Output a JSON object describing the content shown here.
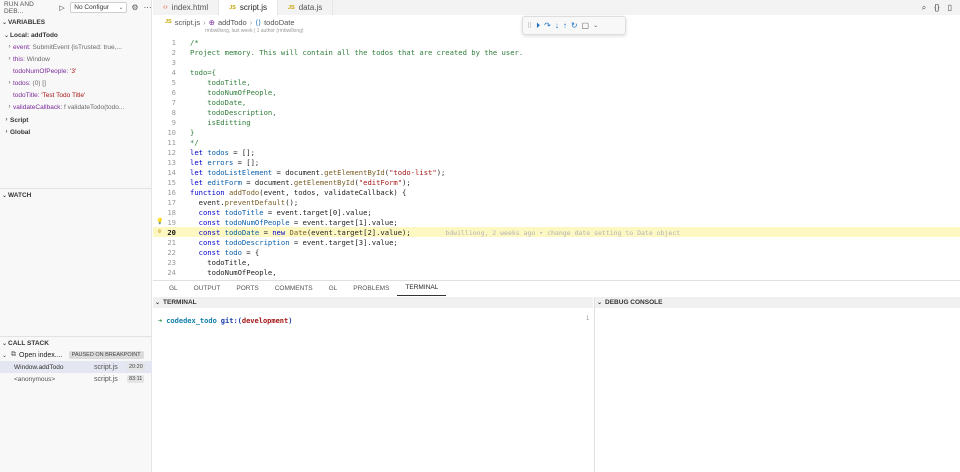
{
  "sidebar": {
    "title": "RUN AND DEB...",
    "config": "No Configur",
    "variables_header": "VARIABLES",
    "local_header": "Local: addTodo",
    "vars": [
      {
        "name": "event:",
        "value": "SubmitEvent {isTrusted: true,..."
      },
      {
        "name": "this:",
        "value": "Window"
      },
      {
        "name": "todoNumOfPeople:",
        "value": "'3'"
      },
      {
        "name": "todos:",
        "value": "(0) []"
      },
      {
        "name": "todoTitle:",
        "value": "'Test Todo Title'"
      },
      {
        "name": "validateCallback:",
        "value": "f validateTodo(todo..."
      }
    ],
    "script_header": "Script",
    "global_header": "Global",
    "watch_header": "WATCH",
    "callstack_header": "CALL STACK",
    "callstack_thread": "Open index....",
    "callstack_status": "PAUSED ON BREAKPOINT",
    "frames": [
      {
        "name": "Window.addTodo",
        "file": "script.js",
        "pos": "20:20"
      },
      {
        "name": "<anonymous>",
        "file": "script.js",
        "pos": "83:11"
      }
    ]
  },
  "tabs": [
    {
      "label": "index.html",
      "kind": "html"
    },
    {
      "label": "script.js",
      "kind": "js"
    },
    {
      "label": "data.js",
      "kind": "js"
    }
  ],
  "tab_right_icons": [
    "search-icon",
    "braces-icon",
    "split-icon"
  ],
  "breadcrumb": {
    "file": "script.js",
    "fn": "addTodo",
    "var": "todoDate"
  },
  "blame": "rmbwillong, last week | 1 author (rmbwillong)",
  "code_lines": [
    {
      "n": "1",
      "html": "<span class='c'>/*</span>"
    },
    {
      "n": "2",
      "html": "<span class='c'>Project memory. This will contain all the todos that are created by the user.</span>"
    },
    {
      "n": "3",
      "html": ""
    },
    {
      "n": "4",
      "html": "<span class='c'>todo={</span>"
    },
    {
      "n": "5",
      "html": "<span class='c'>    todoTitle,</span>"
    },
    {
      "n": "6",
      "html": "<span class='c'>    todoNumOfPeople,</span>"
    },
    {
      "n": "7",
      "html": "<span class='c'>    todoDate,</span>"
    },
    {
      "n": "8",
      "html": "<span class='c'>    todoDescription,</span>"
    },
    {
      "n": "9",
      "html": "<span class='c'>    isEditting</span>"
    },
    {
      "n": "10",
      "html": "<span class='c'>}</span>"
    },
    {
      "n": "11",
      "html": "<span class='c'>*/</span>"
    },
    {
      "n": "12",
      "html": "<span class='k'>let</span> <span class='p'>todos</span> = [];"
    },
    {
      "n": "13",
      "html": "<span class='k'>let</span> <span class='p'>errors</span> = [];"
    },
    {
      "n": "14",
      "html": "<span class='k'>let</span> <span class='p'>todoListElement</span> = document.<span class='f'>getElementById</span>(<span class='s'>\"todo-list\"</span>);"
    },
    {
      "n": "15",
      "html": "<span class='k'>let</span> <span class='p'>editForm</span> = document.<span class='f'>getElementById</span>(<span class='s'>\"editForm\"</span>);"
    },
    {
      "n": "16",
      "html": "<span class='k'>function</span> <span class='f'>addTodo</span>(event, todos, validateCallback) {"
    },
    {
      "n": "17",
      "html": "  event.<span class='f'>preventDefault</span>();"
    },
    {
      "n": "18",
      "html": "  <span class='k'>const</span> <span class='p'>todoTitle</span> = event.target[0].value;"
    },
    {
      "n": "19",
      "html": "  <span class='k'>const</span> <span class='p'>todoNumOfPeople</span> = event.target[1].value;"
    },
    {
      "n": "20",
      "html": "  <span class='k'>const</span> <span class='p'>todoDate</span> = <span class='k'>new</span> <span class='f'>Date</span>(event.target[2].value);        <span class='hint'>bdwilliong, 2 weeks ago • change date setting to Date object</span>"
    },
    {
      "n": "21",
      "html": "  <span class='k'>const</span> <span class='p'>todoDescription</span> = event.target[3].value;"
    },
    {
      "n": "22",
      "html": "  <span class='k'>const</span> <span class='p'>todo</span> = {"
    },
    {
      "n": "23",
      "html": "    todoTitle,"
    },
    {
      "n": "24",
      "html": "    todoNumOfPeople,"
    }
  ],
  "panel_tabs": [
    "GL",
    "OUTPUT",
    "PORTS",
    "COMMENTS",
    "GL",
    "PROBLEMS",
    "TERMINAL"
  ],
  "panel_active": "TERMINAL",
  "terminal_header": "TERMINAL",
  "debug_console_header": "DEBUG CONSOLE",
  "terminal": {
    "arrow": "➜",
    "dir": "codedex_todo",
    "git": "git:(",
    "branch": "development",
    "close": ")"
  },
  "terminal_scroll": "1"
}
